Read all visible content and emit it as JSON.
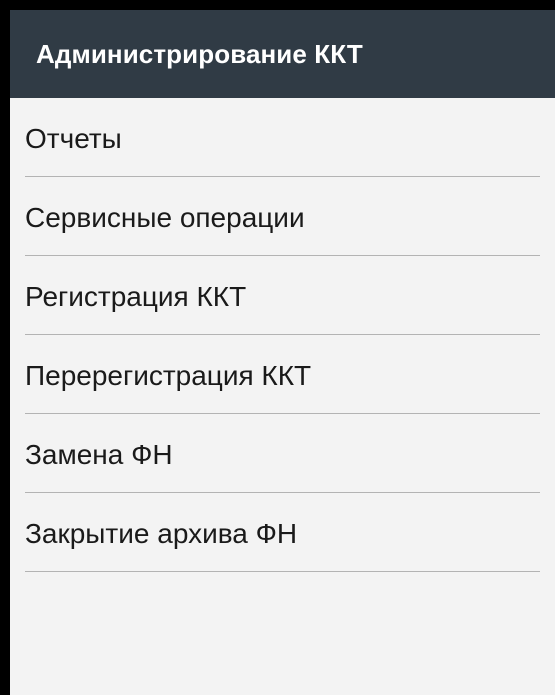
{
  "app_bar": {
    "title": "Администрирование ККТ",
    "background": "#303b45",
    "title_color": "#ffffff"
  },
  "menu": {
    "items": [
      {
        "label": "Отчеты"
      },
      {
        "label": "Сервисные операции"
      },
      {
        "label": "Регистрация ККТ"
      },
      {
        "label": "Перерегистрация ККТ"
      },
      {
        "label": "Замена ФН"
      },
      {
        "label": "Закрытие архива ФН"
      }
    ]
  },
  "colors": {
    "screen_background": "#f3f3f3",
    "divider": "#b3b3b3",
    "text": "#1a1a1a"
  }
}
